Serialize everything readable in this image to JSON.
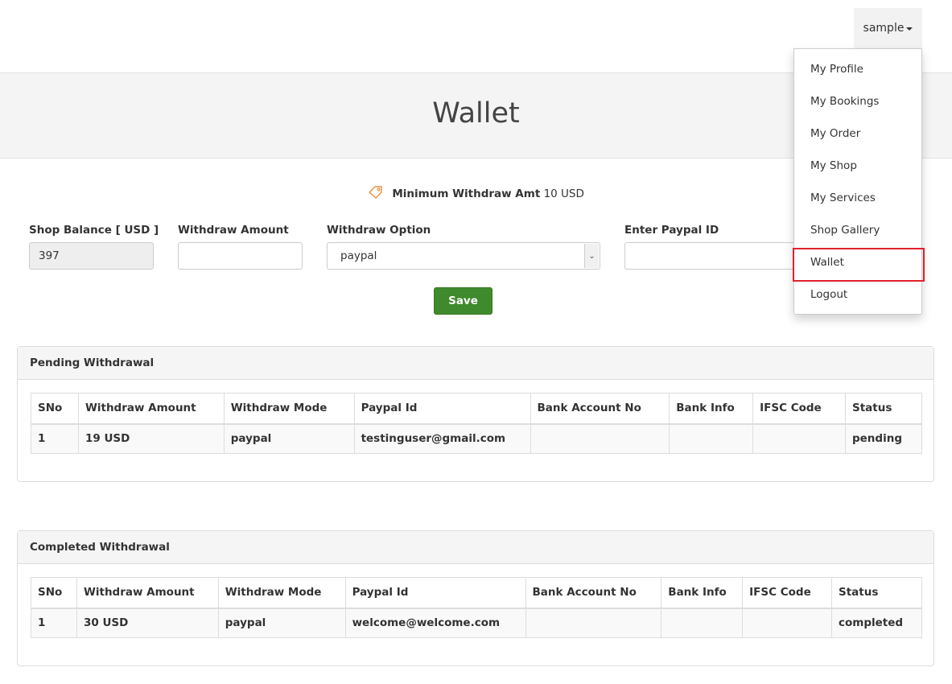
{
  "header": {
    "user_menu_label": "sample"
  },
  "page": {
    "title": "Wallet"
  },
  "min_withdraw": {
    "label": "Minimum Withdraw Amt",
    "amount": "10 USD"
  },
  "form": {
    "shop_balance_label": "Shop Balance [ USD ]",
    "shop_balance_value": "397",
    "withdraw_amount_label": "Withdraw Amount",
    "withdraw_amount_value": "",
    "withdraw_option_label": "Withdraw Option",
    "withdraw_option_value": "paypal",
    "paypal_id_label": "Enter Paypal ID",
    "paypal_id_value": "",
    "save_label": "Save"
  },
  "pending": {
    "title": "Pending Withdrawal",
    "columns": [
      "SNo",
      "Withdraw Amount",
      "Withdraw Mode",
      "Paypal Id",
      "Bank Account No",
      "Bank Info",
      "IFSC Code",
      "Status"
    ],
    "rows": [
      [
        "1",
        "19 USD",
        "paypal",
        "testinguser@gmail.com",
        "",
        "",
        "",
        "pending"
      ]
    ]
  },
  "completed": {
    "title": "Completed Withdrawal",
    "columns": [
      "SNo",
      "Withdraw Amount",
      "Withdraw Mode",
      "Paypal Id",
      "Bank Account No",
      "Bank Info",
      "IFSC Code",
      "Status"
    ],
    "rows": [
      [
        "1",
        "30 USD",
        "paypal",
        "welcome@welcome.com",
        "",
        "",
        "",
        "completed"
      ]
    ]
  },
  "dropdown": {
    "items": [
      "My Profile",
      "My Bookings",
      "My Order",
      "My Shop",
      "My Services",
      "Shop Gallery",
      "Wallet",
      "Logout"
    ],
    "highlighted": "Wallet"
  },
  "colors": {
    "save_button": "#3f8a2c",
    "highlight_border": "#e0212c",
    "tag_icon": "#e8913a"
  },
  "icons": {
    "min_withdraw": "tag-icon",
    "select": "chevron-down-icon",
    "user_menu": "caret-down-icon"
  }
}
